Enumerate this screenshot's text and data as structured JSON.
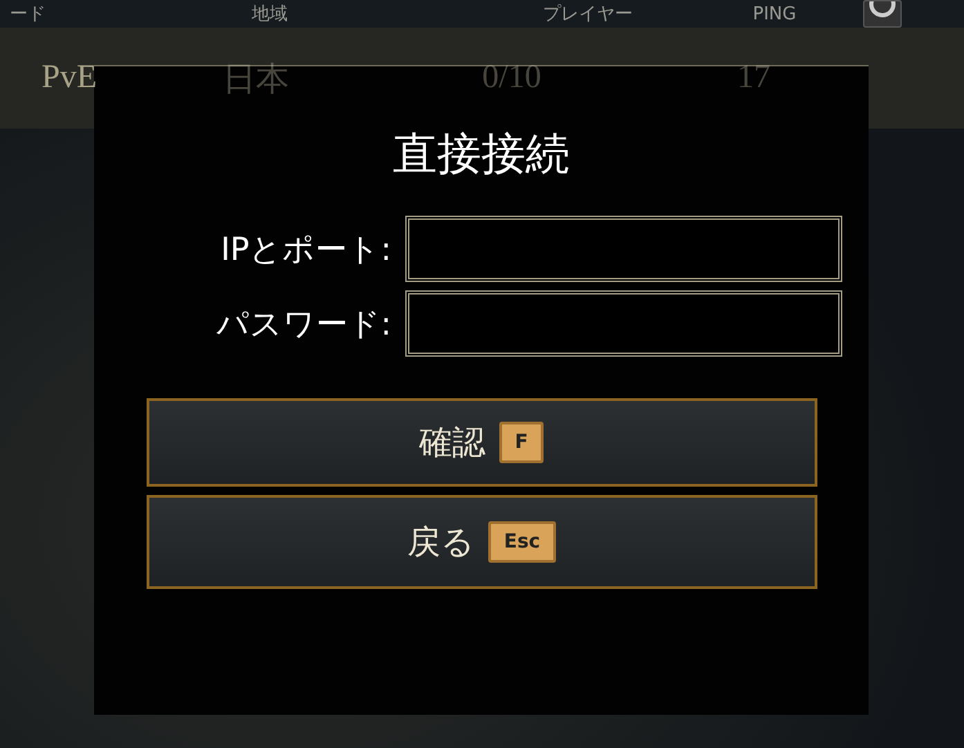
{
  "header": {
    "columns": [
      "ード",
      "地域",
      "プレイヤー",
      "PING"
    ]
  },
  "server_row": {
    "cells": [
      "PvE",
      "日本",
      "0/10",
      "17"
    ]
  },
  "dialog": {
    "title": "直接接続",
    "fields": [
      {
        "label": "IPとポート:"
      },
      {
        "label": "パスワード:"
      }
    ],
    "buttons": [
      {
        "label": "確認",
        "key": "F"
      },
      {
        "label": "戻る",
        "key": "Esc"
      }
    ]
  }
}
